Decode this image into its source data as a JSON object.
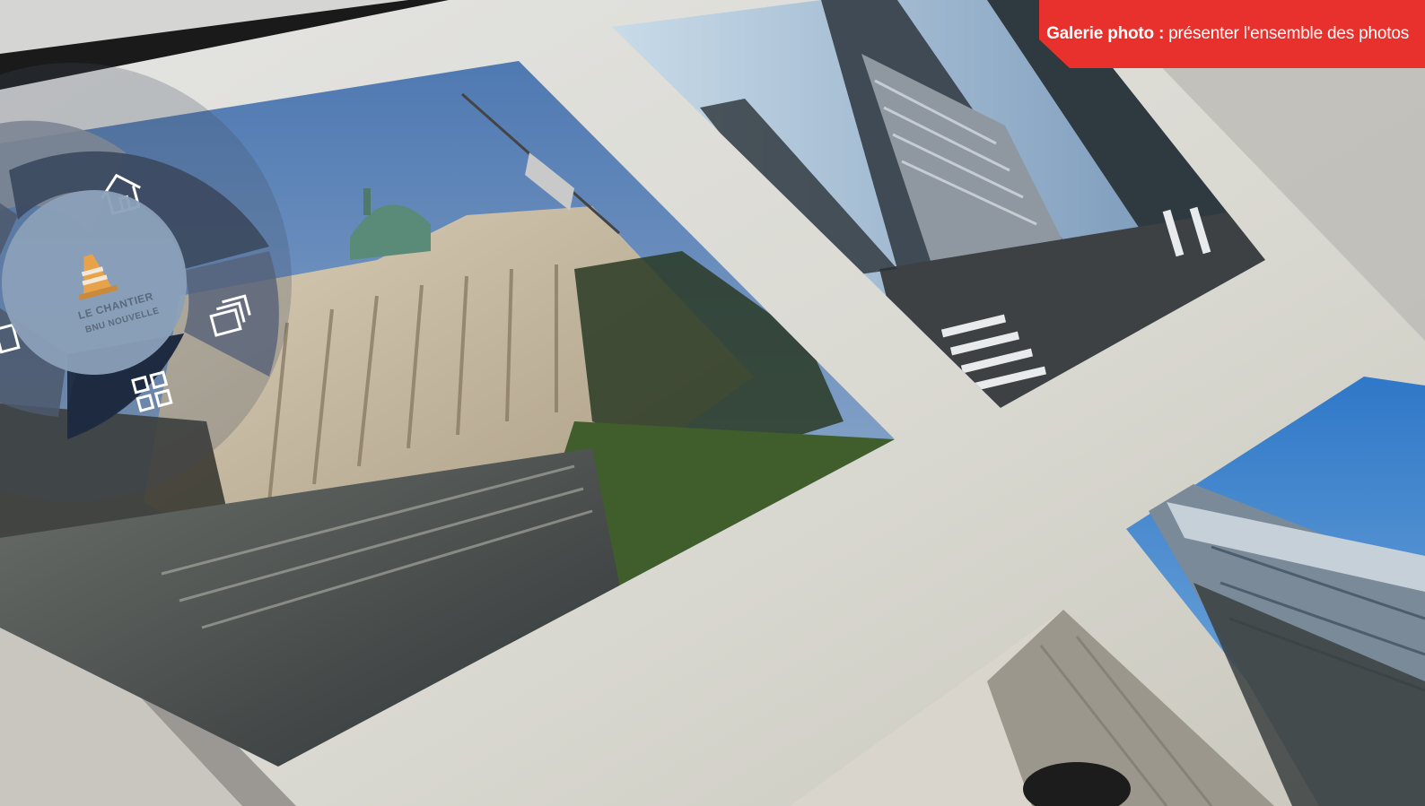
{
  "banner": {
    "title": "Galerie photo :",
    "subtitle": "présenter l'ensemble des photos",
    "color": "#e8312c"
  },
  "radial_menu": {
    "logo_line1": "LE CHANTIER",
    "logo_line2": "BNU NOUVELLE",
    "items": [
      {
        "icon": "home-icon"
      },
      {
        "icon": "gallery-stack-icon"
      },
      {
        "icon": "grid-icon"
      },
      {
        "icon": "document-icon"
      }
    ]
  },
  "colors": {
    "menu_segment": "#3c4a60",
    "menu_segment_active": "#1e2a40",
    "menu_center": "#8ba0b8",
    "table_surface": "#d8d8d3"
  }
}
